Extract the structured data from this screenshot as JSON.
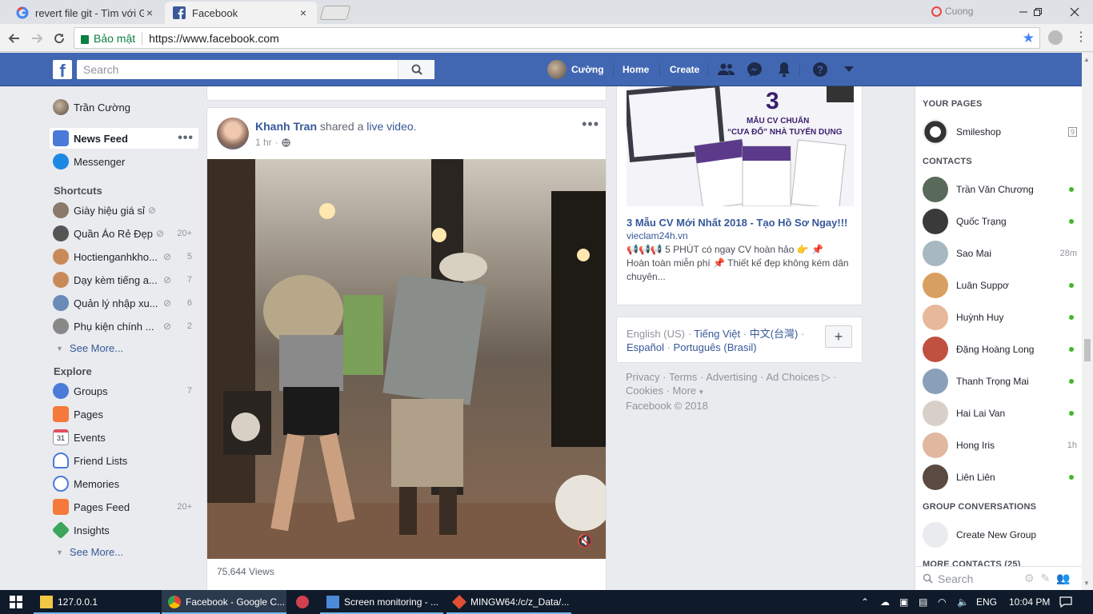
{
  "browser": {
    "tabs": [
      {
        "title": "revert file git - Tìm với Go",
        "icon": "google-icon"
      },
      {
        "title": "Facebook",
        "icon": "facebook-icon"
      }
    ],
    "profile_name": "Cuong",
    "security_label": "Bảo mật",
    "url": "https://www.facebook.com",
    "close_glyph": "×"
  },
  "fb": {
    "logo_glyph": "f",
    "search_placeholder": "Search",
    "user_name": "Cường",
    "nav": {
      "home": "Home",
      "create": "Create"
    }
  },
  "leftnav": {
    "profile": "Trần Cường",
    "news_feed": "News Feed",
    "messenger": "Messenger",
    "shortcuts_header": "Shortcuts",
    "shortcuts": [
      {
        "label": "Giày hiệu giá sỉ",
        "count": ""
      },
      {
        "label": "Quần Áo Rẻ Đẹp",
        "count": "20+"
      },
      {
        "label": "Hoctienganhkho...",
        "count": "5"
      },
      {
        "label": "Dạy kèm tiếng a...",
        "count": "7"
      },
      {
        "label": "Quản lý nhập xu...",
        "count": "6"
      },
      {
        "label": "Phụ kiện chính ...",
        "count": "2"
      }
    ],
    "see_more": "See More...",
    "explore_header": "Explore",
    "explore": [
      {
        "label": "Groups",
        "count": "7",
        "icon": "groups-icon",
        "color": "#4b7bd8"
      },
      {
        "label": "Pages",
        "count": "",
        "icon": "pages-flag-icon",
        "color": "#f5793a"
      },
      {
        "label": "Events",
        "count": "",
        "icon": "events-calendar-icon",
        "color": "#e04f5f"
      },
      {
        "label": "Friend Lists",
        "count": "",
        "icon": "friend-lists-icon",
        "color": "#4b7bd8"
      },
      {
        "label": "Memories",
        "count": "",
        "icon": "memories-clock-icon",
        "color": "#4b7bd8"
      },
      {
        "label": "Pages Feed",
        "count": "20+",
        "icon": "pages-feed-icon",
        "color": "#f5793a"
      },
      {
        "label": "Insights",
        "count": "",
        "icon": "insights-cube-icon",
        "color": "#3ba55c"
      }
    ]
  },
  "post": {
    "author": "Khanh Tran",
    "shared_text": " shared a ",
    "live_video": "live video",
    "period": ".",
    "time": "1 hr",
    "views": "75,644 Views"
  },
  "ad": {
    "image_number": "3",
    "image_line1": "MẪU CV CHUẨN",
    "image_line2": "“CƯA ĐỔ” NHÀ TUYỂN DỤNG",
    "title": "3 Mẫu CV Mới Nhất 2018 - Tạo Hồ Sơ Ngay!!!",
    "domain": "vieclam24h.vn",
    "body_line1": "📢📢📢 5 PHÚT có ngay CV hoàn hảo 👉 📌",
    "body_line2": "Hoàn toàn miễn phí 📌 Thiết kế đẹp không kém dân chuyên..."
  },
  "languages": {
    "current": "English (US)",
    "options": [
      "Tiếng Việt",
      "中文(台灣)",
      "Español",
      "Português (Brasil)"
    ],
    "separator": " · ",
    "plus": "+"
  },
  "footer": {
    "links": [
      "Privacy",
      "Terms",
      "Advertising",
      "Ad Choices"
    ],
    "cookies": "Cookies",
    "more": "More",
    "copyright": "Facebook © 2018"
  },
  "chat": {
    "your_pages_header": "YOUR PAGES",
    "pages": [
      {
        "name": "Smileshop",
        "badge": "9"
      }
    ],
    "contacts_header": "CONTACTS",
    "contacts": [
      {
        "name": "Trần Văn Chương",
        "status": "online",
        "ago": ""
      },
      {
        "name": "Quốc Trạng",
        "status": "online",
        "ago": ""
      },
      {
        "name": "Sao Mai",
        "status": "away",
        "ago": "28m"
      },
      {
        "name": "Luân Suppơ",
        "status": "online",
        "ago": ""
      },
      {
        "name": "Huỳnh Huy",
        "status": "online",
        "ago": ""
      },
      {
        "name": "Đặng Hoàng Long",
        "status": "online",
        "ago": ""
      },
      {
        "name": "Thanh Trọng Mai",
        "status": "online",
        "ago": ""
      },
      {
        "name": "Hai Lai Van",
        "status": "online",
        "ago": ""
      },
      {
        "name": "Hong Iris",
        "status": "away",
        "ago": "1h"
      },
      {
        "name": "Liên Liên",
        "status": "online",
        "ago": ""
      }
    ],
    "group_header": "GROUP CONVERSATIONS",
    "create_group": "Create New Group",
    "more_contacts_header": "MORE CONTACTS (25)",
    "search_placeholder": "Search"
  },
  "taskbar": {
    "items": [
      {
        "label": "127.0.0.1",
        "icon": "folder-icon"
      },
      {
        "label": "Facebook - Google C...",
        "icon": "chrome-icon"
      },
      {
        "label": "",
        "icon": "app-icon"
      },
      {
        "label": "Screen monitoring - ...",
        "icon": "screen-monitoring-icon"
      },
      {
        "label": "MINGW64:/c/z_Data/...",
        "icon": "git-bash-icon"
      }
    ],
    "lang": "ENG",
    "time": "10:04 PM"
  }
}
